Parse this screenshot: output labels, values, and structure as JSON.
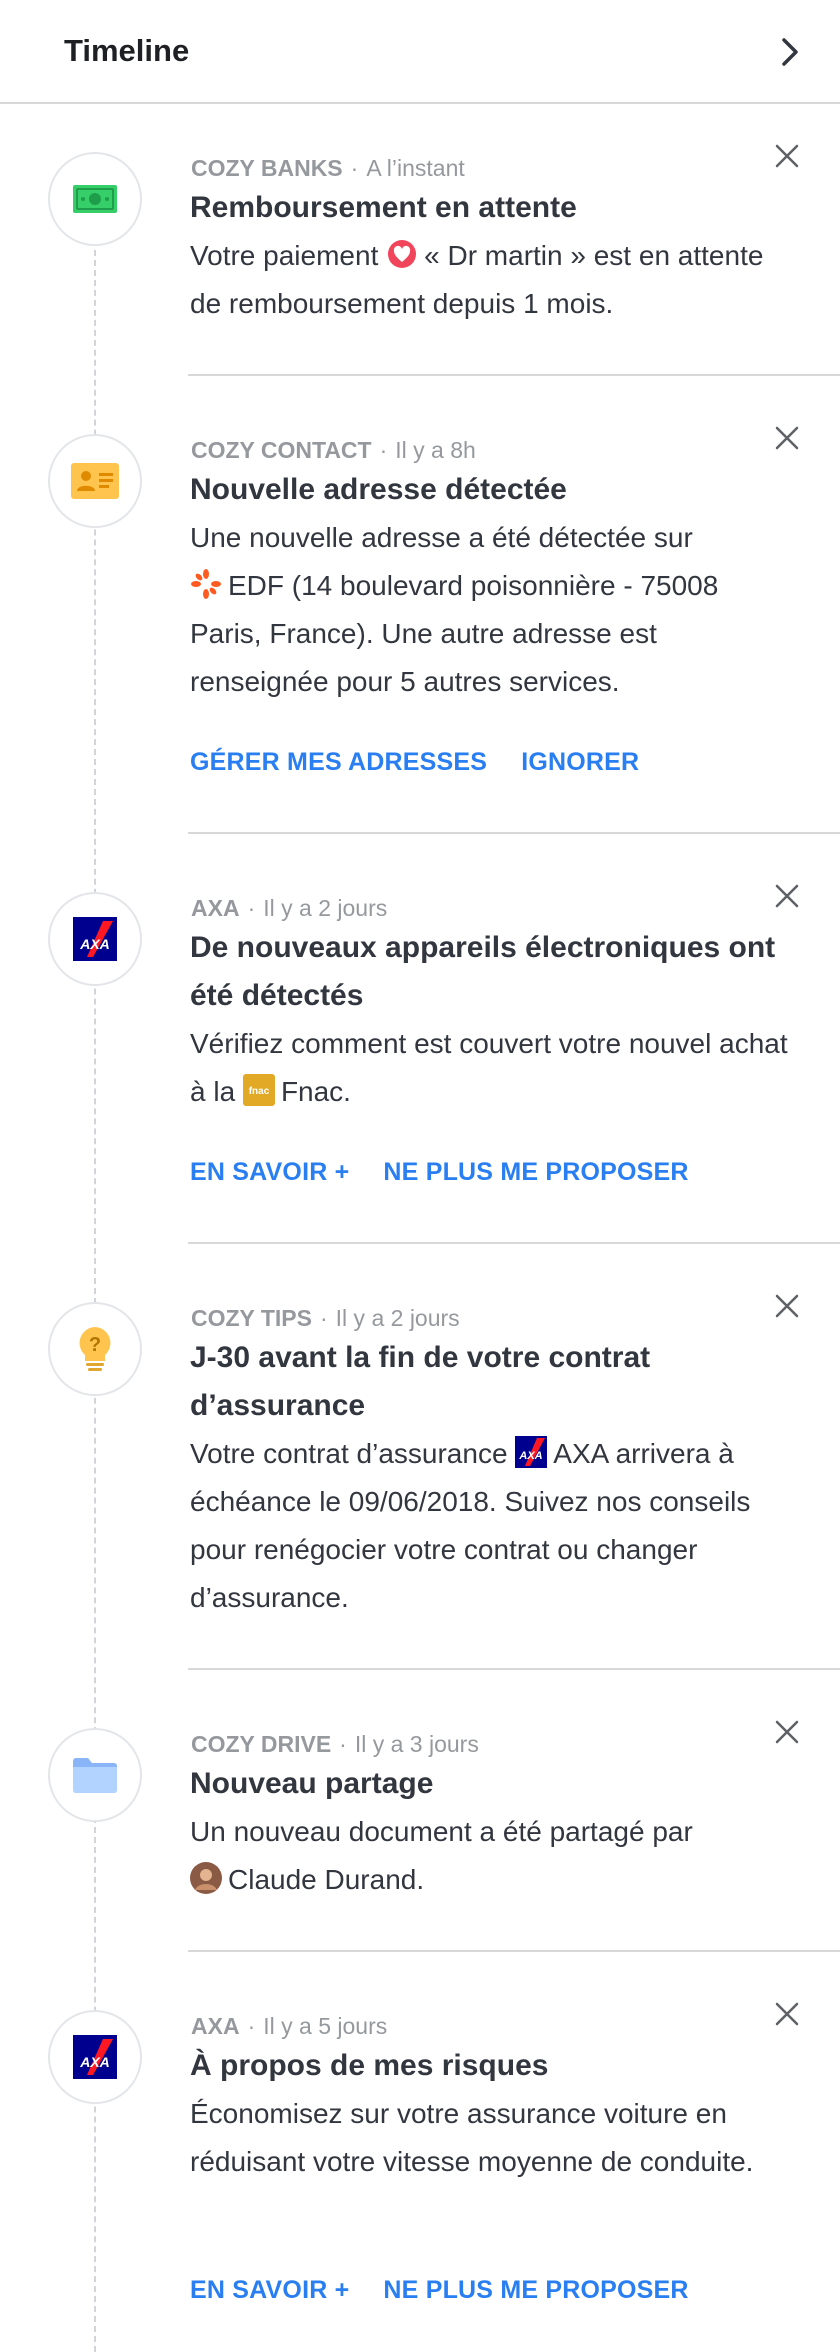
{
  "header": {
    "title": "Timeline",
    "chevron_icon": "chevron-right-icon"
  },
  "colors": {
    "accent": "#297ef2",
    "text": "#32363f",
    "muted": "#95999d",
    "divider": "#d6d8da"
  },
  "items": [
    {
      "source": "COZY BANKS",
      "time": "A l’instant",
      "title": "Remboursement en attente",
      "icon": "banknote-icon",
      "body_before": "Votre paiement",
      "body_inline_label": "« Dr martin »",
      "body_after": "est en attente de remboursement depuis 1 mois."
    },
    {
      "source": "COZY CONTACT",
      "time": "Il y a 8h",
      "title": "Nouvelle adresse détectée",
      "icon": "contact-card-icon",
      "body_before": "Une nouvelle adresse a été détectée sur",
      "body_inline_label": "EDF",
      "body_after": "(14 boulevard poisonnière - 75008 Paris, France). Une autre adresse est renseignée pour 5 autres services.",
      "actions": [
        "GÉRER MES ADRESSES",
        "IGNORER"
      ]
    },
    {
      "source": "AXA",
      "time": "Il y a 2 jours",
      "title": "De nouveaux appareils électroniques ont été détectés",
      "icon": "axa-logo-icon",
      "body_before": "Vérifiez comment est couvert votre nouvel achat à la",
      "body_inline_label": "Fnac.",
      "body_after": "",
      "actions": [
        "EN SAVOIR +",
        "NE PLUS ME PROPOSER"
      ]
    },
    {
      "source": "COZY TIPS",
      "time": "Il y a 2 jours",
      "title": "J-30 avant la fin de votre contrat d’assurance",
      "icon": "lightbulb-icon",
      "body_before": "Votre contrat d’assurance",
      "body_inline_label": "AXA",
      "body_after": "arrivera à échéance le 09/06/2018. Suivez nos conseils pour renégocier votre contrat ou changer d’assurance."
    },
    {
      "source": "COZY DRIVE",
      "time": "Il y a 3 jours",
      "title": "Nouveau partage",
      "icon": "folder-icon",
      "body_before": "Un nouveau document a été partagé par",
      "body_inline_label": "Claude Durand.",
      "body_after": ""
    },
    {
      "source": "AXA",
      "time": "Il y a 5 jours",
      "title": "À propos de mes risques",
      "icon": "axa-logo-icon",
      "body_before": "Économisez sur votre assurance voiture en réduisant votre vitesse moyenne de conduite.",
      "body_inline_label": "",
      "body_after": "",
      "actions": [
        "EN SAVOIR +",
        "NE PLUS ME PROPOSER"
      ]
    }
  ]
}
